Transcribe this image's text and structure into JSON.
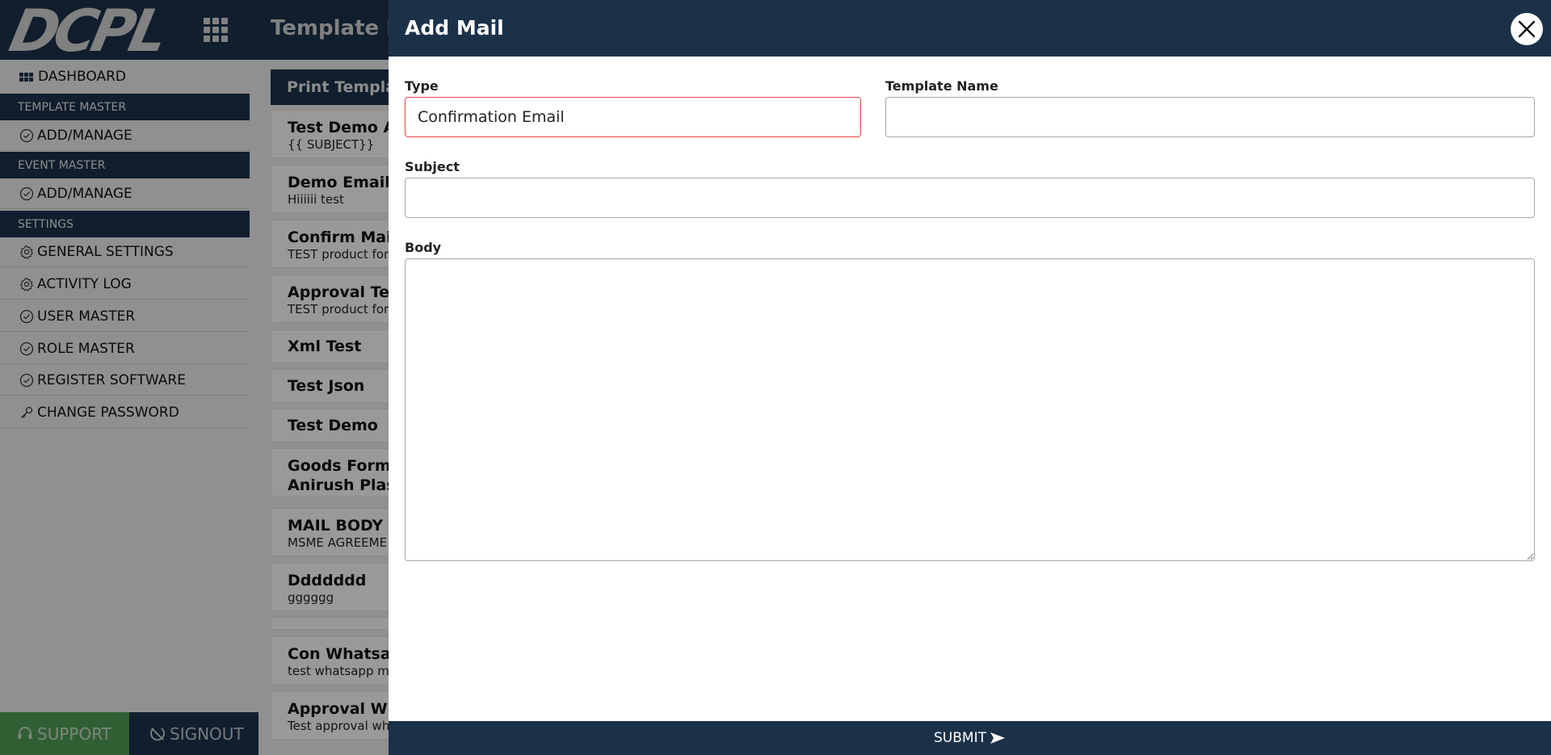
{
  "app": {
    "logo_text": "DCPL",
    "page_title": "Template Ma"
  },
  "sidebar": {
    "dashboard": "DASHBOARD",
    "sections": [
      {
        "header": "TEMPLATE MASTER",
        "items": [
          "ADD/MANAGE"
        ]
      },
      {
        "header": "EVENT MASTER",
        "items": [
          "ADD/MANAGE"
        ]
      },
      {
        "header": "SETTINGS",
        "items": [
          "GENERAL SETTINGS",
          "ACTIVITY LOG",
          "USER MASTER",
          "ROLE MASTER",
          "REGISTER SOFTWARE",
          "CHANGE PASSWORD"
        ]
      }
    ],
    "support_label": "SUPPORT",
    "signout_label": "SIGNOUT"
  },
  "template_list": {
    "header": "Print Templat",
    "items": [
      {
        "title": "Test Demo Ap",
        "subtitle": "{{ SUBJECT}}"
      },
      {
        "title": "Demo Email T",
        "subtitle": "Hiiiiii test"
      },
      {
        "title": "Confirm Mail T",
        "subtitle": "TEST product for"
      },
      {
        "title": "Approval Test",
        "subtitle": "TEST product for"
      },
      {
        "title": "Xml Test",
        "subtitle": ""
      },
      {
        "title": "Test Json",
        "subtitle": ""
      },
      {
        "title": "Test Demo",
        "subtitle": ""
      },
      {
        "title": "Goods Forma",
        "subtitle": "Anirush Plast"
      },
      {
        "title": "MAIL BODY",
        "subtitle": "MSME AGREEME"
      },
      {
        "title": "Ddddddd",
        "subtitle": "gggggg"
      },
      {
        "title": "",
        "subtitle": ""
      },
      {
        "title": "Con Whatsap",
        "subtitle": "test whatsapp m"
      },
      {
        "title": "Approval Wha",
        "subtitle": "Test approval wh"
      }
    ]
  },
  "modal": {
    "title": "Add Mail",
    "type_label": "Type",
    "type_value": "Confirmation Email",
    "template_name_label": "Template Name",
    "template_name_value": "",
    "subject_label": "Subject",
    "subject_value": "",
    "body_label": "Body",
    "body_value": "",
    "submit_label": "SUBMIT"
  },
  "colors": {
    "navy": "#1b3149",
    "support_green": "#4e9a53",
    "invalid_red": "#e04848"
  }
}
